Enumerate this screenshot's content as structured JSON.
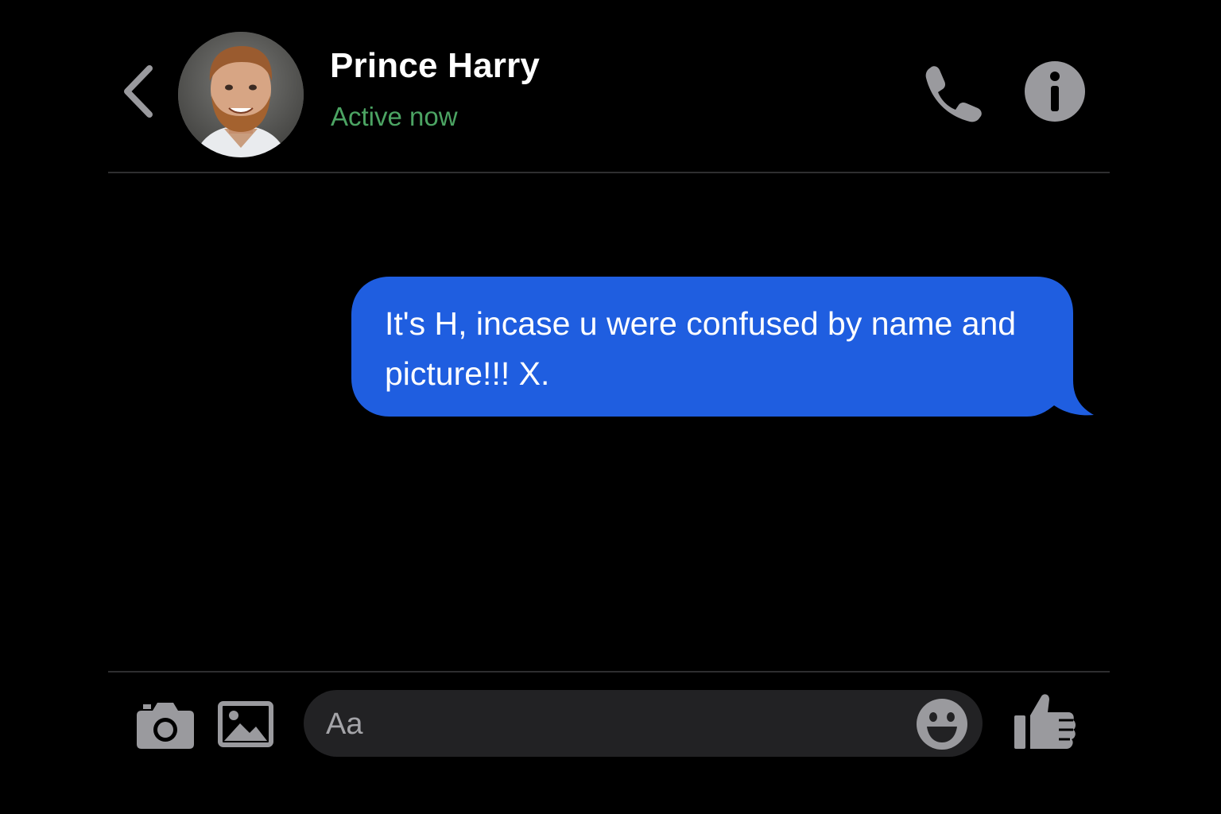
{
  "header": {
    "contact_name": "Prince Harry",
    "status": "Active now",
    "status_color": "#4ca463"
  },
  "icons": {
    "back": "chevron-left-icon",
    "call": "phone-icon",
    "info": "info-icon",
    "camera": "camera-icon",
    "gallery": "image-icon",
    "emoji": "smiley-icon",
    "like": "thumbs-up-icon"
  },
  "messages": [
    {
      "direction": "outgoing",
      "text": "It's H, incase u were confused by name and picture!!! X.",
      "bubble_color": "#1f5ee0"
    }
  ],
  "composer": {
    "placeholder": "Aa"
  },
  "colors": {
    "background": "#000000",
    "icon_gray": "#9a9a9e",
    "divider": "#2e2e30",
    "composer_bg": "#222224"
  }
}
